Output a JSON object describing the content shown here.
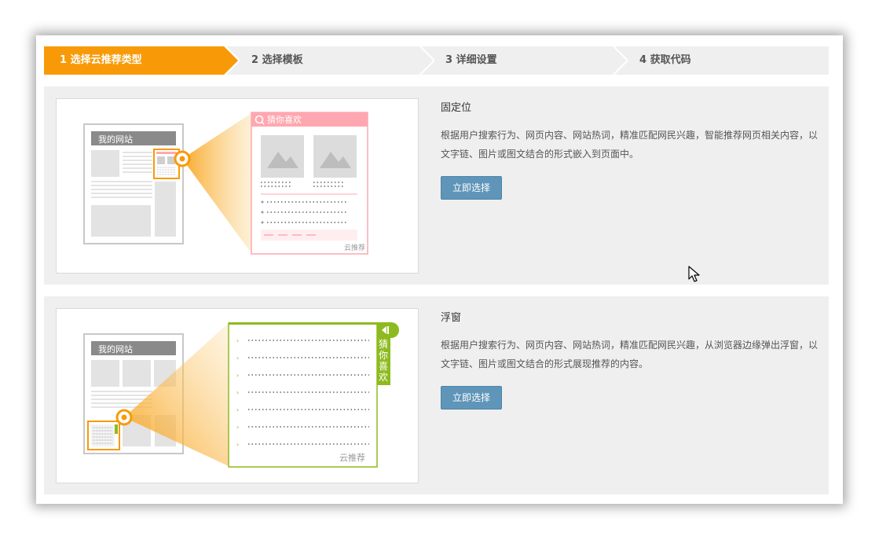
{
  "steps": [
    {
      "label": "1 选择云推荐类型",
      "active": true
    },
    {
      "label": "2 选择模板",
      "active": false
    },
    {
      "label": "3 详细设置",
      "active": false
    },
    {
      "label": "4 获取代码",
      "active": false
    }
  ],
  "options": [
    {
      "title": "固定位",
      "desc": "根据用户搜索行为、网页内容、网站热词，精准匹配网民兴趣，智能推荐网页相关内容，以文字链、图片或图文结合的形式嵌入到页面中。",
      "button": "立即选择",
      "illustration": {
        "site_label": "我的网站",
        "widget_title": "猜你喜欢",
        "brand": "云推荐",
        "accent": "#f89a07",
        "widget_color": "#ffa7b0"
      }
    },
    {
      "title": "浮窗",
      "desc": "根据用户搜索行为、网页内容、网站热词，精准匹配网民兴趣，从浏览器边缘弹出浮窗，以文字链、图片或图文结合的形式展现推荐的内容。",
      "button": "立即选择",
      "illustration": {
        "site_label": "我的网站",
        "widget_title": "猜你喜欢",
        "widget_title_chars": [
          "猜",
          "你",
          "喜",
          "欢"
        ],
        "brand": "云推荐",
        "accent": "#f89a07",
        "widget_color": "#8dbb1f"
      }
    }
  ],
  "colors": {
    "active_step": "#f89a07",
    "button": "#5e95b8",
    "panel_bg": "#efefef"
  }
}
